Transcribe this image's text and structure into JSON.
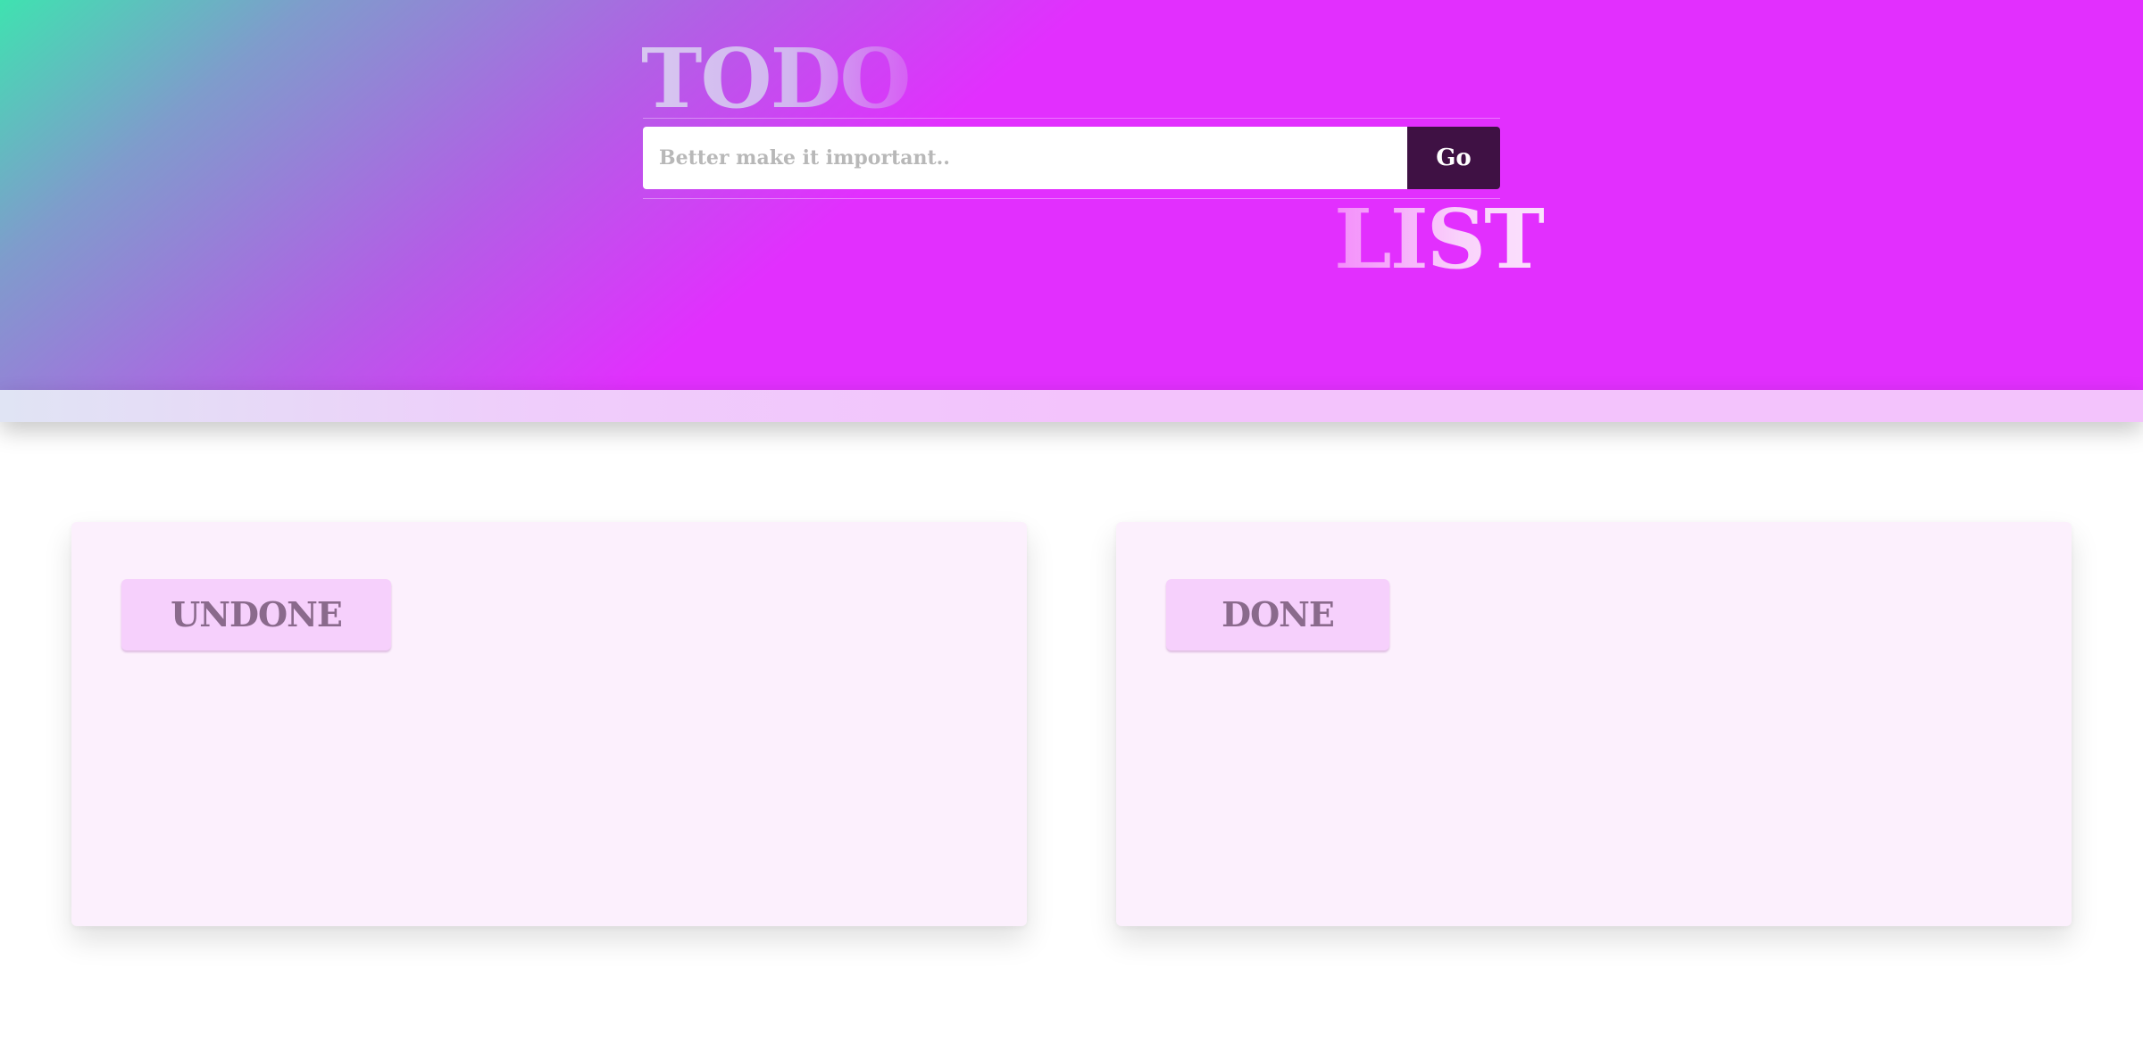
{
  "header": {
    "title_top": "TODO",
    "title_bottom": "LIST",
    "input_placeholder": "Better make it important..",
    "input_value": "",
    "submit_label": "Go"
  },
  "lists": {
    "undone": {
      "label": "UNDONE",
      "items": []
    },
    "done": {
      "label": "DONE",
      "items": []
    }
  },
  "colors": {
    "gradient_start": "#3fe2b0",
    "gradient_end": "#e22ffe",
    "button_bg": "#3f1144",
    "card_bg": "#fcf0fd",
    "label_bg": "#f6d0fc"
  }
}
